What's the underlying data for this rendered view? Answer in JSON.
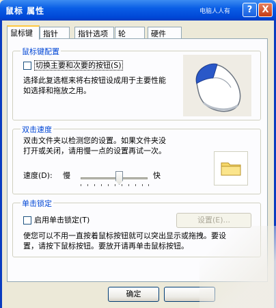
{
  "window": {
    "title": "鼠标 属性",
    "watermark": "电脑人人有",
    "help_label": "?",
    "close_label": "X"
  },
  "tabs": [
    {
      "label": "鼠标键",
      "active": true
    },
    {
      "label": "指针"
    },
    {
      "label": "指针选项"
    },
    {
      "label": "轮"
    },
    {
      "label": "硬件"
    }
  ],
  "button_config": {
    "group_label": "鼠标键配置",
    "checkbox_label": "切换主要和次要的按钮(S)",
    "checked": false,
    "desc_line1": "选择此复选框来将右按钮设成用于主要性能",
    "desc_line2": "如选择和拖放之用。"
  },
  "double_click": {
    "group_label": "双击速度",
    "desc_line1": "双击文件夹以检测您的设置。如果文件夹没",
    "desc_line2": "打开或关闭，请用慢一点的设置再试一次。",
    "speed_label": "速度(D):",
    "slow_label": "慢",
    "fast_label": "快",
    "speed_fraction": 0.55
  },
  "click_lock": {
    "group_label": "单击锁定",
    "checkbox_label": "启用单击锁定(T)",
    "checked": false,
    "settings_label": "设置(E)...",
    "desc_line1": "使您可以不用一直按着鼠标按钮就可以突出显示或拖拽。要设",
    "desc_line2": "置，请按下鼠标按钮。要放开请再单击鼠标按钮。"
  },
  "footer": {
    "ok_label": "确定",
    "cancel_label": ""
  },
  "colors": {
    "title_bar": "#0a5ee6",
    "group_label": "#0046d5",
    "dialog_bg": "#ece9d8",
    "panel_bg": "#fcfcfe",
    "tab_highlight": "#ffc73c",
    "mouse_accent": "#2a58c8"
  },
  "icons": [
    "help-icon",
    "close-icon",
    "mouse-icon",
    "folder-icon"
  ]
}
